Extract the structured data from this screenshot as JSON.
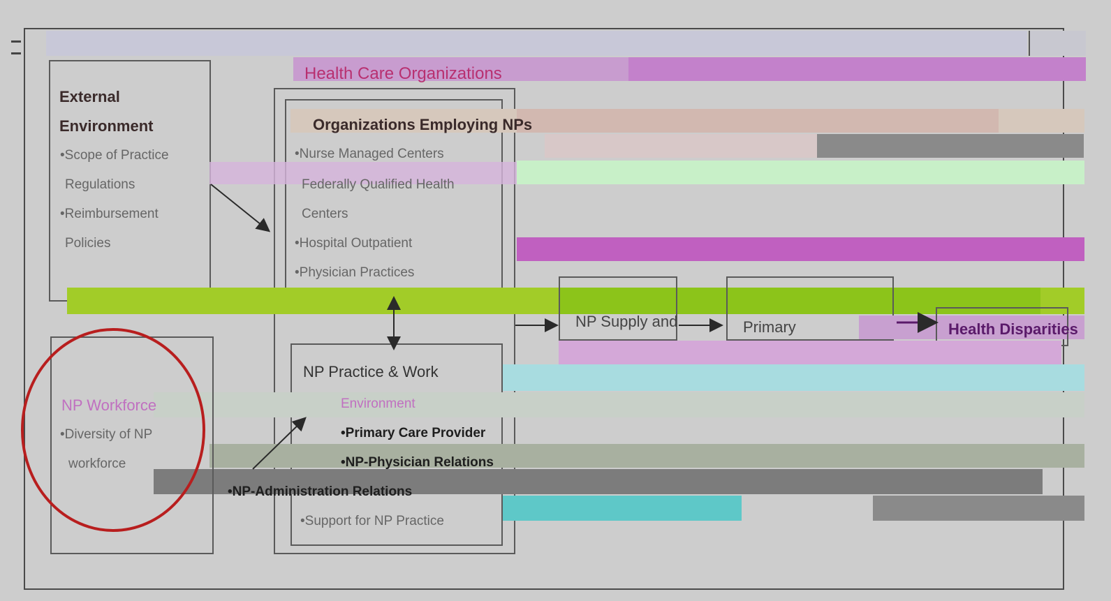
{
  "top_label": "Health Care Organizations",
  "external": {
    "title_lines": [
      "External",
      "Environment"
    ],
    "items": [
      "•Scope of Practice",
      "Regulations",
      "•Reimbursement",
      "Policies"
    ]
  },
  "orgs": {
    "title": "Organizations Employing NPs",
    "items": [
      "•Nurse Managed Centers",
      "Federally Qualified Health",
      "Centers",
      "•Hospital Outpatient",
      "•Physician Practices"
    ]
  },
  "np_practice": {
    "title": "NP Practice & Work",
    "subtitle": "Environment",
    "items": [
      "•Primary Care Provider",
      "•NP-Physician Relations",
      "•NP-Administration Relations",
      "•Support for NP Practice"
    ]
  },
  "np_workforce": {
    "title": "NP Workforce",
    "items": [
      "•Diversity of NP",
      "workforce"
    ]
  },
  "outcomes": {
    "supply": "NP Supply and",
    "primary": "Primary",
    "disparities": "Health Disparities"
  },
  "colors": {
    "magenta": "#c86ec8",
    "green": "#9ccc1e",
    "circle": "#b81e1e"
  }
}
